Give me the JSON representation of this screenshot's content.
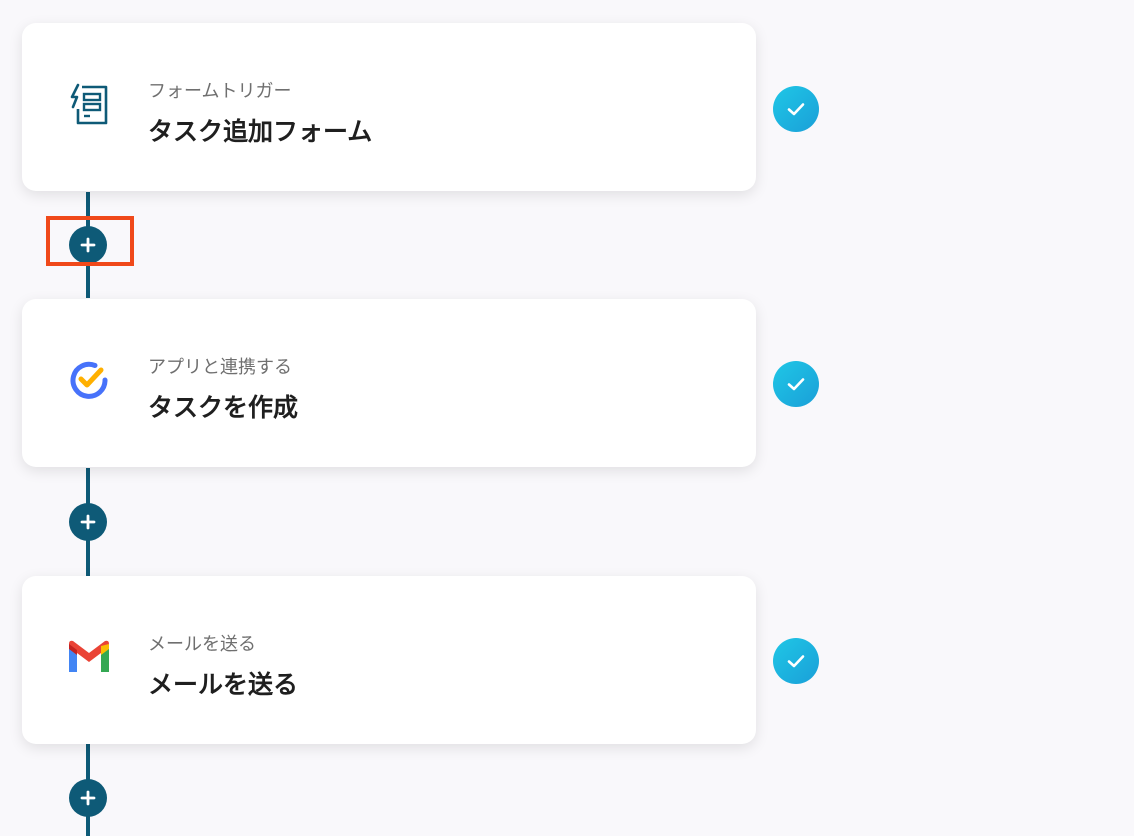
{
  "steps": [
    {
      "subtitle": "フォームトリガー",
      "title": "タスク追加フォーム",
      "icon": "form-trigger-icon",
      "status": "completed"
    },
    {
      "subtitle": "アプリと連携する",
      "title": "タスクを作成",
      "icon": "ticktick-icon",
      "status": "completed"
    },
    {
      "subtitle": "メールを送る",
      "title": "メールを送る",
      "icon": "gmail-icon",
      "status": "completed"
    }
  ],
  "colors": {
    "connector": "#0e5a77",
    "add_button": "#0e5a77",
    "check_gradient_start": "#1fc7e6",
    "check_gradient_end": "#1a9fd8",
    "highlight": "#f0491a",
    "background": "#f9f8fb"
  }
}
